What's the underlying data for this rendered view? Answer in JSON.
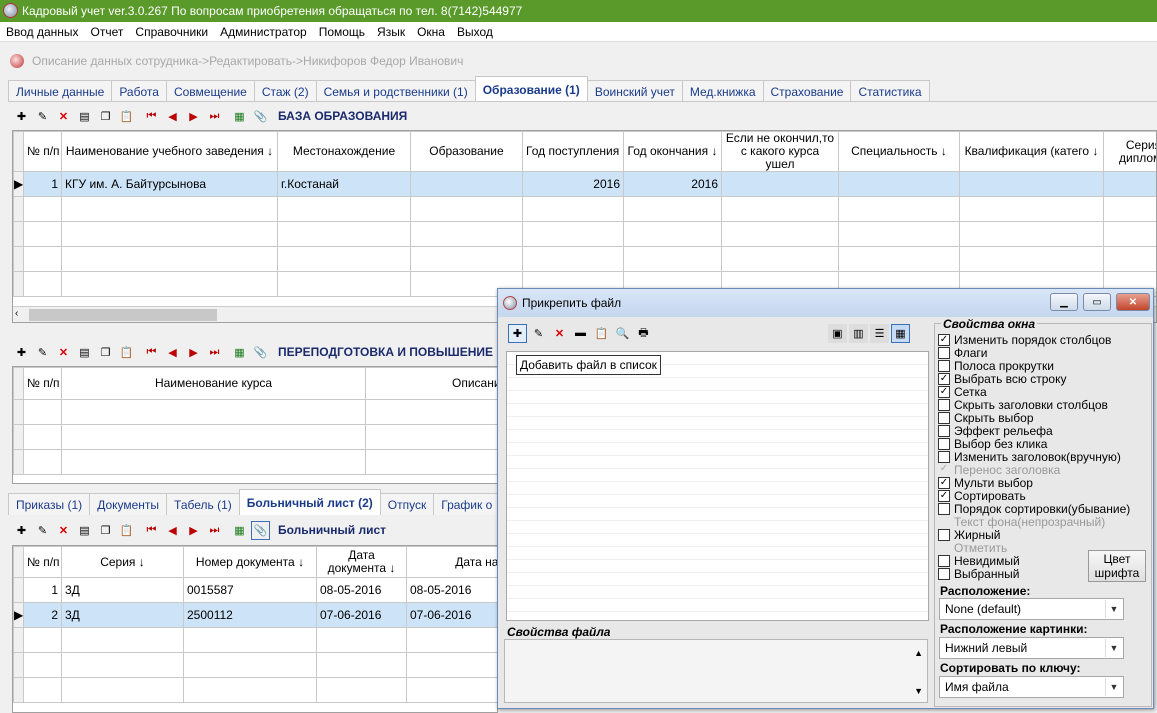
{
  "app": {
    "title": "Кадровый учет ver.3.0.267 По вопросам приобретения обращаться по тел. 8(7142)544977"
  },
  "menu": [
    "Ввод данных",
    "Отчет",
    "Справочники",
    "Администратор",
    "Помощь",
    "Язык",
    "Окна",
    "Выход"
  ],
  "breadcrumb": "Описание данных сотрудника->Редактировать->Никифоров Федор Иванович",
  "top_tabs": [
    {
      "label": "Личные данные"
    },
    {
      "label": "Работа"
    },
    {
      "label": "Совмещение"
    },
    {
      "label": "Стаж (2)"
    },
    {
      "label": "Семья и родственники (1)"
    },
    {
      "label": "Образование (1)",
      "active": true
    },
    {
      "label": "Воинский учет"
    },
    {
      "label": "Мед.книжка"
    },
    {
      "label": "Страхование"
    },
    {
      "label": "Статистика"
    }
  ],
  "education": {
    "section_title": "БАЗА ОБРАЗОВАНИЯ",
    "columns": [
      "№ п/п",
      "Наименование учебного заведения",
      "Местонахождение",
      "Образование",
      "Год поступления",
      "Год окончания",
      "Если не окончил,то с какого курса ушел",
      "Специальность",
      "Квалификация (катего",
      "Серия диплома"
    ],
    "rows": [
      {
        "num": "1",
        "name": "КГУ им. А. Байтурсынова",
        "location": "г.Костанай",
        "education": "",
        "year_in": "2016",
        "year_out": "2016"
      }
    ]
  },
  "retraining": {
    "section_title": "ПЕРЕПОДГОТОВКА И ПОВЫШЕНИЕ К",
    "columns": [
      "№ п/п",
      "Наименование курса",
      "Описани"
    ]
  },
  "bottom_tabs": [
    {
      "label": "Приказы (1)"
    },
    {
      "label": "Документы"
    },
    {
      "label": "Табель (1)"
    },
    {
      "label": "Больничный лист (2)",
      "active": true
    },
    {
      "label": "Отпуск"
    },
    {
      "label": "График о"
    }
  ],
  "sick": {
    "section_title": "Больничный лист",
    "columns": [
      "№ п/п",
      "Серия",
      "Номер документа",
      "Дата документа",
      "Дата начала"
    ],
    "rows": [
      {
        "num": "1",
        "series": "3Д",
        "doc_num": "0015587",
        "doc_date": "08-05-2016",
        "start": "08-05-2016"
      },
      {
        "num": "2",
        "series": "3Д",
        "doc_num": "2500112",
        "doc_date": "07-06-2016",
        "start": "07-06-2016"
      }
    ]
  },
  "dialog": {
    "title": "Прикрепить файл",
    "tooltip": "Добавить файл в список",
    "window_props_label": "Свойства окна",
    "file_props_label": "Свойства файла",
    "options": [
      {
        "label": "Изменить порядок столбцов",
        "checked": true
      },
      {
        "label": "Флаги",
        "checked": false
      },
      {
        "label": "Полоса прокрутки",
        "checked": false
      },
      {
        "label": "Выбрать всю строку",
        "checked": true
      },
      {
        "label": "Сетка",
        "checked": true
      },
      {
        "label": "Скрыть заголовки столбцов",
        "checked": false
      },
      {
        "label": "Скрыть выбор",
        "checked": false
      },
      {
        "label": "Эффект рельефа",
        "checked": false
      },
      {
        "label": "Выбор без клика",
        "checked": false
      },
      {
        "label": "Изменить заголовок(вручную)",
        "checked": false
      },
      {
        "label": "Перенос заголовка",
        "checked": true,
        "disabled": true
      },
      {
        "label": "Мульти выбор",
        "checked": true
      },
      {
        "label": "Сортировать",
        "checked": true
      },
      {
        "label": "Порядок сортировки(убывание)",
        "checked": false
      },
      {
        "label": "Текст фона(непрозрачный)",
        "disabled": true,
        "nobox": true
      },
      {
        "label": "Жирный",
        "checked": false
      },
      {
        "label": "Отметить",
        "disabled": true,
        "nobox": true
      },
      {
        "label": "Невидимый",
        "checked": false
      },
      {
        "label": "Выбранный",
        "checked": false
      }
    ],
    "font_color_button": "Цвет шрифта",
    "location_label": "Расположение:",
    "location_value": "None (default)",
    "image_location_label": "Расположение картинки:",
    "image_location_value": "Нижний левый",
    "sort_key_label": "Сортировать по ключу:",
    "sort_key_value": "Имя файла"
  }
}
